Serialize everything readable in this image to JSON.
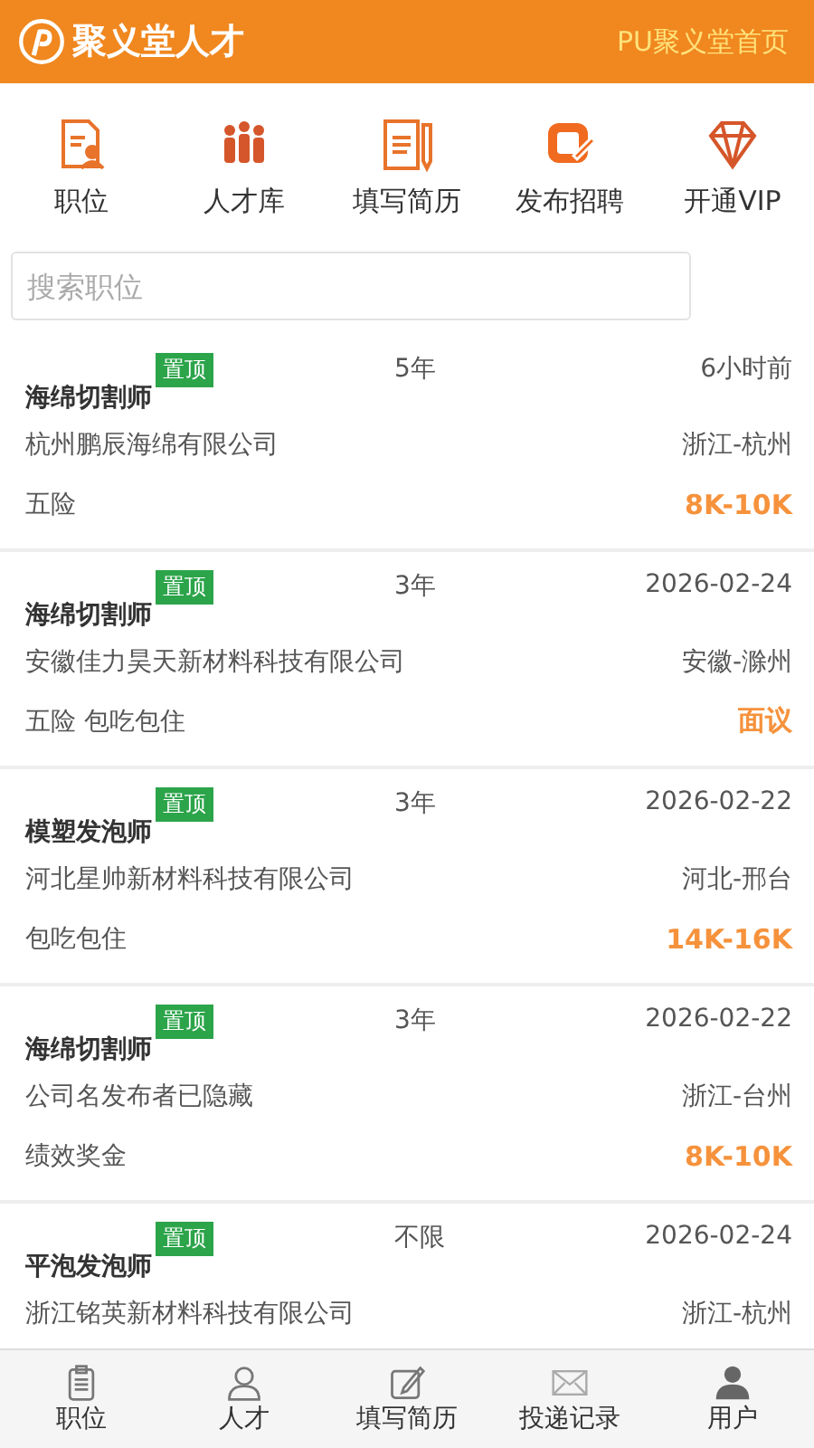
{
  "header": {
    "title": "聚义堂人才",
    "link": "PU聚义堂首页"
  },
  "quick_menu": [
    {
      "label": "职位",
      "kind": "resume"
    },
    {
      "label": "人才库",
      "kind": "people"
    },
    {
      "label": "填写简历",
      "kind": "document"
    },
    {
      "label": "发布招聘",
      "kind": "publish"
    },
    {
      "label": "开通VIP",
      "kind": "diamond"
    }
  ],
  "search": {
    "placeholder": "搜索职位"
  },
  "jobs": [
    {
      "title": "海绵切割师",
      "badge": "置顶",
      "experience": "5年",
      "time": "6小时前",
      "company": "杭州鹏辰海绵有限公司",
      "location": "浙江-杭州",
      "benefits": "五险",
      "salary": "8K-10K"
    },
    {
      "title": "海绵切割师",
      "badge": "置顶",
      "experience": "3年",
      "time": "2026-02-24",
      "company": "安徽佳力昊天新材料科技有限公司",
      "location": "安徽-滁州",
      "benefits": "五险 包吃包住",
      "salary": "面议"
    },
    {
      "title": "模塑发泡师",
      "badge": "置顶",
      "experience": "3年",
      "time": "2026-02-22",
      "company": "河北星帅新材料科技有限公司",
      "location": "河北-邢台",
      "benefits": "包吃包住",
      "salary": "14K-16K"
    },
    {
      "title": "海绵切割师",
      "badge": "置顶",
      "experience": "3年",
      "time": "2026-02-22",
      "company": "公司名发布者已隐藏",
      "location": "浙江-台州",
      "benefits": "绩效奖金",
      "salary": "8K-10K"
    },
    {
      "title": "平泡发泡师",
      "badge": "置顶",
      "experience": "不限",
      "time": "2026-02-24",
      "company": "浙江铭英新材料科技有限公司",
      "location": "浙江-杭州"
    }
  ],
  "bottom_nav": [
    {
      "label": "职位",
      "kind": "clipboard"
    },
    {
      "label": "人才",
      "kind": "person"
    },
    {
      "label": "填写简历",
      "kind": "edit"
    },
    {
      "label": "投递记录",
      "kind": "mail"
    },
    {
      "label": "用户",
      "kind": "user"
    }
  ]
}
